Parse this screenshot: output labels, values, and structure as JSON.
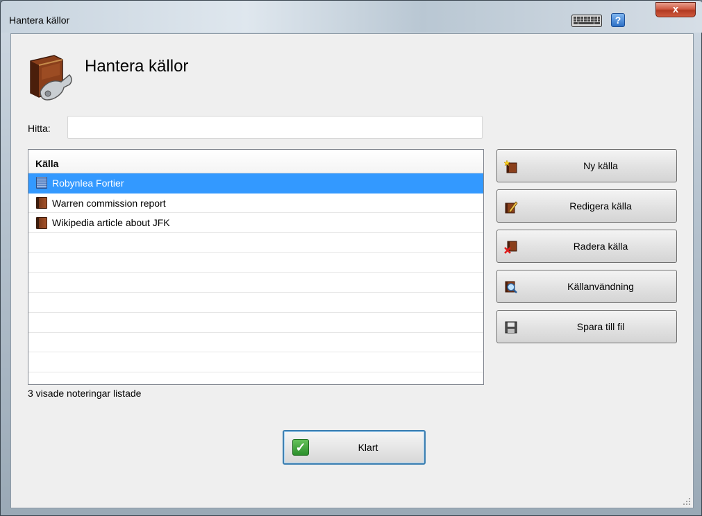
{
  "window": {
    "title": "Hantera källor",
    "close_label": "x",
    "help_label": "?",
    "icons": {
      "keyboard": "keyboard-icon",
      "help": "help-icon",
      "close": "close-icon"
    }
  },
  "header": {
    "heading": "Hantera källor",
    "icon": "source-book-wrench-icon"
  },
  "search": {
    "label": "Hitta:",
    "value": "",
    "placeholder": ""
  },
  "list": {
    "column_header": "Källa",
    "rows": [
      {
        "label": "Robynlea Fortier",
        "icon": "book-blue-icon",
        "selected": true
      },
      {
        "label": "Warren commission report",
        "icon": "book-icon",
        "selected": false
      },
      {
        "label": "Wikipedia article about JFK",
        "icon": "book-icon",
        "selected": false
      }
    ],
    "empty_rows": 7
  },
  "status": "3 visade noteringar listade",
  "actions": [
    {
      "label": "Ny källa",
      "icon": "new-source-icon"
    },
    {
      "label": "Redigera källa",
      "icon": "edit-source-icon"
    },
    {
      "label": "Radera källa",
      "icon": "delete-source-icon"
    },
    {
      "label": "Källanvändning",
      "icon": "source-usage-icon"
    },
    {
      "label": "Spara till fil",
      "icon": "save-to-file-icon"
    }
  ],
  "done_button": {
    "label": "Klart",
    "icon": "checkmark-icon"
  },
  "colors": {
    "selection": "#3399ff",
    "done_border": "#3c7fb1"
  }
}
